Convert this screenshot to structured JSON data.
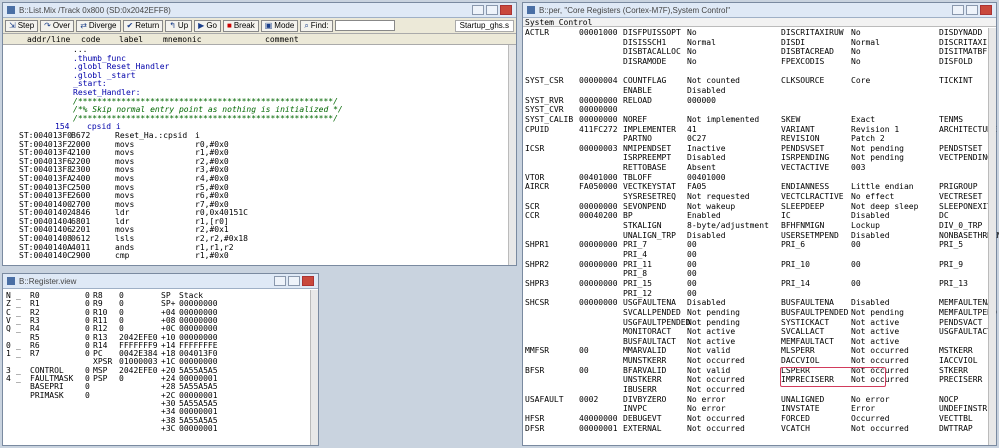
{
  "list_win": {
    "title": "B::List.Mix /Track 0x800 (SD:0x2042EFF8)",
    "toolbar": [
      "Step",
      "Over",
      "Diverge",
      "Return",
      "Up",
      "Go",
      "Break",
      "Mode"
    ],
    "find_label": "Find:",
    "file": "Startup_ghs.s",
    "cols": [
      "addr/line",
      "code",
      "label",
      "mnemonic",
      "comment"
    ],
    "src": [
      {
        "t": "...",
        "c": "pl"
      },
      {
        "t": ".thumb_func",
        "c": "lbl"
      },
      {
        "t": ".globl Reset_Handler",
        "c": "lbl"
      },
      {
        "t": ".globl _start",
        "c": "lbl"
      },
      {
        "t": "_start:",
        "c": "lbl"
      },
      {
        "t": "Reset_Handler:",
        "c": "lbl"
      },
      {
        "t": "/*****************************************************/",
        "c": "cmt"
      },
      {
        "t": "/*% Skip normal entry point as nothing is initialized */",
        "c": "cmt"
      },
      {
        "t": "/*****************************************************/",
        "c": "cmt"
      }
    ],
    "line154": "154",
    "line154_txt": "cpsid i",
    "rows": [
      [
        "ST:004013F0",
        "B672",
        "Reset_Ha.:cpsid",
        "i"
      ],
      [
        "ST:004013F2",
        "2000",
        "movs",
        "r0,#0x0"
      ],
      [
        "ST:004013F4",
        "2100",
        "movs",
        "r1,#0x0"
      ],
      [
        "ST:004013F6",
        "2200",
        "movs",
        "r2,#0x0"
      ],
      [
        "ST:004013F8",
        "2300",
        "movs",
        "r3,#0x0"
      ],
      [
        "ST:004013FA",
        "2400",
        "movs",
        "r4,#0x0"
      ],
      [
        "ST:004013FC",
        "2500",
        "movs",
        "r5,#0x0"
      ],
      [
        "ST:004013FE",
        "2600",
        "movs",
        "r6,#0x0"
      ],
      [
        "ST:00401400",
        "2700",
        "movs",
        "r7,#0x0"
      ],
      [
        "ST:00401402",
        "4846",
        "ldr",
        "r0,0x40151C"
      ],
      [
        "ST:00401404",
        "6801",
        "ldr",
        "r1,[r0]"
      ],
      [
        "ST:00401406",
        "2201",
        "movs",
        "r2,#0x1"
      ],
      [
        "ST:00401408",
        "0612",
        "lsls",
        "r2,r2,#0x18"
      ],
      [
        "ST:0040140A",
        "4011",
        "ands",
        "r1,r1,r2"
      ],
      [
        "ST:0040140C",
        "2900",
        "cmp",
        "r1,#0x0"
      ]
    ]
  },
  "reg_win": {
    "title": "B::Register.view",
    "flags": [
      [
        "N",
        "_"
      ],
      [
        "Z",
        "_"
      ],
      [
        "C",
        "_"
      ],
      [
        "V",
        "_"
      ],
      [
        "Q",
        "_"
      ],
      [
        "",
        ""
      ],
      [
        "0",
        "_"
      ],
      [
        "1",
        "_"
      ],
      [
        "",
        ""
      ],
      [
        "3",
        "_"
      ],
      [
        "4",
        "_"
      ]
    ],
    "c1": [
      [
        "R0",
        "0"
      ],
      [
        "R1",
        "0"
      ],
      [
        "R2",
        "0"
      ],
      [
        "R3",
        "0"
      ],
      [
        "R4",
        "0"
      ],
      [
        "R5",
        "0"
      ],
      [
        "R6",
        "0"
      ],
      [
        "R7",
        "0"
      ],
      [
        "",
        ""
      ],
      [
        "CONTROL",
        "0"
      ],
      [
        "FAULTMASK",
        "0"
      ],
      [
        "BASEPRI",
        "0"
      ],
      [
        "PRIMASK",
        "0"
      ]
    ],
    "c2": [
      [
        "R8",
        "0"
      ],
      [
        "R9",
        "0"
      ],
      [
        "R10",
        "0"
      ],
      [
        "R11",
        "0"
      ],
      [
        "R12",
        "0"
      ],
      [
        "R13",
        "2042EFE0"
      ],
      [
        "R14",
        "FFFFFFF9"
      ],
      [
        "PC",
        "0042E384"
      ],
      [
        "XPSR",
        "01000003"
      ],
      [
        "MSP",
        "2042EFE0"
      ],
      [
        "PSP",
        "0"
      ]
    ],
    "stack": [
      [
        "SP",
        "",
        "Stack"
      ],
      [
        "SP+",
        "",
        "00000000"
      ],
      [
        "+04",
        "",
        "00000000"
      ],
      [
        "+08",
        "",
        "00000000"
      ],
      [
        "+0C",
        "",
        "00000000"
      ],
      [
        "+10",
        "",
        "00000000"
      ],
      [
        "+14",
        "",
        "FFFFFFFE"
      ],
      [
        "+18",
        "",
        "004013F0"
      ],
      [
        "+1C",
        "",
        "00000000"
      ],
      [
        "+20",
        "",
        "5A55A5A5"
      ],
      [
        "+24",
        "",
        "00000001"
      ],
      [
        "+28",
        "",
        "5A55A5A5"
      ],
      [
        "+2C",
        "",
        "00000001"
      ],
      [
        "+30",
        "",
        "5A55A5A5"
      ],
      [
        "+34",
        "",
        "00000001"
      ],
      [
        "+38",
        "",
        "5A55A5A5"
      ],
      [
        "+3C",
        "",
        "00000001"
      ]
    ]
  },
  "core_win": {
    "title": "B::per, \"Core Registers (Cortex-M7F),System Control\"",
    "tab": "System Control",
    "rows": [
      [
        "ACTLR",
        "00001000",
        "DISFPUISSOPT",
        "No",
        "DISCRITAXIRUW",
        "No",
        "DISDYNADD"
      ],
      [
        "",
        "",
        "DISISSCH1",
        "Normal",
        "DISDI",
        "Normal",
        "DISCRITAXI"
      ],
      [
        "",
        "",
        "DISBTACALLOC",
        "No",
        "DISBTACREAD",
        "No",
        "DISITMATBF"
      ],
      [
        "",
        "",
        "DISRAMODE",
        "No",
        "FPEXCODIS",
        "No",
        "DISFOLD"
      ],
      [
        "",
        "",
        "",
        "",
        "",
        "",
        ""
      ],
      [
        "SYST_CSR",
        "00000004",
        "COUNTFLAG",
        "Not counted",
        "CLKSOURCE",
        "Core",
        "TICKINT"
      ],
      [
        "",
        "",
        "ENABLE",
        "Disabled",
        "",
        "",
        ""
      ],
      [
        "SYST_RVR",
        "00000000",
        "RELOAD",
        "000000",
        "",
        "",
        ""
      ],
      [
        "SYST_CVR",
        "00000000",
        "",
        "",
        "",
        "",
        ""
      ],
      [
        "SYST_CALIB",
        "00000000",
        "NOREF",
        "Not implemented",
        "SKEW",
        "Exact",
        "TENMS"
      ],
      [
        "CPUID",
        "411FC272",
        "IMPLEMENTER",
        "41",
        "VARIANT",
        "Revision 1",
        "ARCHITECTURE"
      ],
      [
        "",
        "",
        "PARTNO",
        "0C27",
        "REVISION",
        "Patch 2",
        ""
      ],
      [
        "ICSR",
        "00000003",
        "NMIPENDSET",
        "Inactive",
        "PENDSVSET",
        "Not pending",
        "PENDSTSET"
      ],
      [
        "",
        "",
        "ISRPREEMPT",
        "Disabled",
        "ISRPENDING",
        "Not pending",
        "VECTPENDING"
      ],
      [
        "",
        "",
        "RETTOBASE",
        "Absent",
        "VECTACTIVE",
        "003",
        ""
      ],
      [
        "VTOR",
        "00401000",
        "TBLOFF",
        "00401000",
        "",
        "",
        ""
      ],
      [
        "AIRCR",
        "FA050000",
        "VECTKEYSTAT",
        "FA05",
        "ENDIANNESS",
        "Little endian",
        "PRIGROUP"
      ],
      [
        "",
        "",
        "SYSRESETREQ",
        "Not requested",
        "VECTCLRACTIVE",
        "No effect",
        "VECTRESET"
      ],
      [
        "SCR",
        "00000000",
        "SEVONPEND",
        "Not wakeup",
        "SLEEPDEEP",
        "Not deep sleep",
        "SLEEPONEXIT"
      ],
      [
        "CCR",
        "00040200",
        "BP",
        "Enabled",
        "IC",
        "Disabled",
        "DC"
      ],
      [
        "",
        "",
        "STKALIGN",
        "8-byte/adjustment",
        "BFHFNMIGN",
        "Lockup",
        "DIV_0_TRP"
      ],
      [
        "",
        "",
        "UNALIGN_TRP",
        "Disabled",
        "USERSETMPEND",
        "Disabled",
        "NONBASETHRDENA"
      ],
      [
        "SHPR1",
        "00000000",
        "PRI_7",
        "00",
        "PRI_6",
        "00",
        "PRI_5"
      ],
      [
        "",
        "",
        "PRI_4",
        "00",
        "",
        "",
        ""
      ],
      [
        "SHPR2",
        "00000000",
        "PRI_11",
        "00",
        "PRI_10",
        "00",
        "PRI_9"
      ],
      [
        "",
        "",
        "PRI_8",
        "00",
        "",
        "",
        ""
      ],
      [
        "SHPR3",
        "00000000",
        "PRI_15",
        "00",
        "PRI_14",
        "00",
        "PRI_13"
      ],
      [
        "",
        "",
        "PRI_12",
        "00",
        "",
        "",
        ""
      ],
      [
        "SHCSR",
        "00000000",
        "USGFAULTENA",
        "Disabled",
        "BUSFAULTENA",
        "Disabled",
        "MEMFAULTENA"
      ],
      [
        "",
        "",
        "SVCALLPENDED",
        "Not pending",
        "BUSFAULTPENDED",
        "Not pending",
        "MEMFAULTPEND"
      ],
      [
        "",
        "",
        "USGFAULTPENDED",
        "Not pending",
        "SYSTICKACT",
        "Not active",
        "PENDSVACT"
      ],
      [
        "",
        "",
        "MONITORACT",
        "Not active",
        "SVCALLACT",
        "Not active",
        "USGFAULTACT"
      ],
      [
        "",
        "",
        "BUSFAULTACT",
        "Not active",
        "MEMFAULTACT",
        "Not active",
        ""
      ],
      [
        "MMFSR",
        "00",
        "MMARVALID",
        "Not valid",
        "MLSPERR",
        "Not occurred",
        "MSTKERR"
      ],
      [
        "",
        "",
        "MUNSTKERR",
        "Not occurred",
        "DACCVIOL",
        "Not occurred",
        "IACCVIOL"
      ],
      [
        "BFSR",
        "00",
        "BFARVALID",
        "Not valid",
        "LSPERR",
        "Not occurred",
        "STKERR"
      ],
      [
        "",
        "",
        "UNSTKERR",
        "Not occurred",
        "IMPRECISERR",
        "Not occurred",
        "PRECISERR"
      ],
      [
        "",
        "",
        "IBUSERR",
        "Not occurred",
        "",
        "",
        ""
      ],
      [
        "USAFAULT",
        "0002",
        "DIVBYZERO",
        "No error",
        "UNALIGNED",
        "No error",
        "NOCP"
      ],
      [
        "",
        "",
        "INVPC",
        "No error",
        "INVSTATE",
        "Error",
        "UNDEFINSTR"
      ],
      [
        "HFSR",
        "40000000",
        "DEBUGEVT",
        "Not occurred",
        "FORCED",
        "Occurred",
        "VECTTBL"
      ],
      [
        "DFSR",
        "00000001",
        "EXTERNAL",
        "Not occurred",
        "VCATCH",
        "Not occurred",
        "DWTTRAP"
      ]
    ]
  }
}
